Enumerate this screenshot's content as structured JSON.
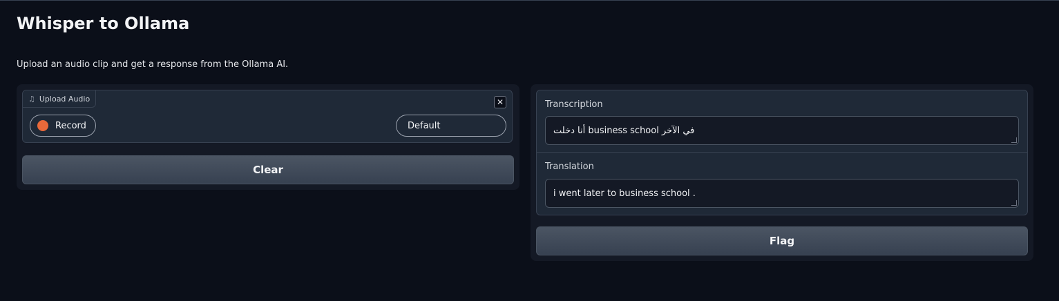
{
  "header": {
    "title": "Whisper to Ollama",
    "description": "Upload an audio clip and get a response from the Ollama AI."
  },
  "audio": {
    "tab_label": "Upload Audio",
    "tab_icon": "music-note-icon",
    "close_symbol": "✕",
    "record_label": "Record",
    "device_value": "Default",
    "record_color": "#e8693a"
  },
  "buttons": {
    "clear_label": "Clear",
    "flag_label": "Flag"
  },
  "outputs": {
    "transcription_label": "Transcription",
    "transcription_value": "أنا دخلت business school في الآخر",
    "translation_label": "Translation",
    "translation_value": "i went later to business school ."
  }
}
